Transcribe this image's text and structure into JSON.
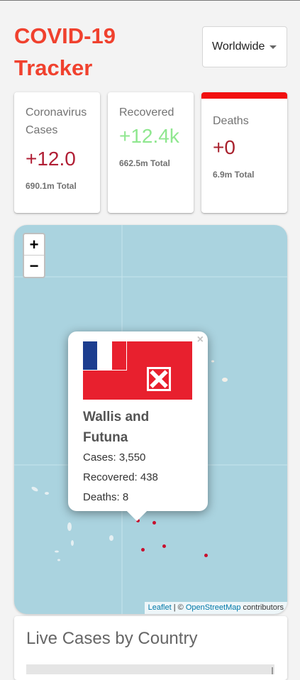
{
  "header": {
    "title": "COVID-19 Tracker",
    "country_select": {
      "value": "Worldwide"
    }
  },
  "cards": {
    "cases": {
      "title": "Coronavirus Cases",
      "value": "+12.0",
      "total": "690.1m Total"
    },
    "recovered": {
      "title": "Recovered",
      "value": "+12.4k",
      "total": "662.5m Total"
    },
    "deaths": {
      "title": "Deaths",
      "value": "+0",
      "total": "6.9m Total"
    }
  },
  "map": {
    "zoom_in": "+",
    "zoom_out": "−",
    "attribution": {
      "leaflet": "Leaflet",
      "sep": " | © ",
      "osm": "OpenStreetMap",
      "suffix": " contributors"
    },
    "popup": {
      "close": "×",
      "country": "Wallis and Futuna",
      "cases": "Cases: 3,550",
      "recovered": "Recovered: 438",
      "deaths": "Deaths: 8"
    }
  },
  "live_cases": {
    "title": "Live Cases by Country"
  },
  "colors": {
    "accent": "#f0412e",
    "deaths_bar": "#f10f0f",
    "recovered": "#8fe78f",
    "water": "#aad3df"
  }
}
